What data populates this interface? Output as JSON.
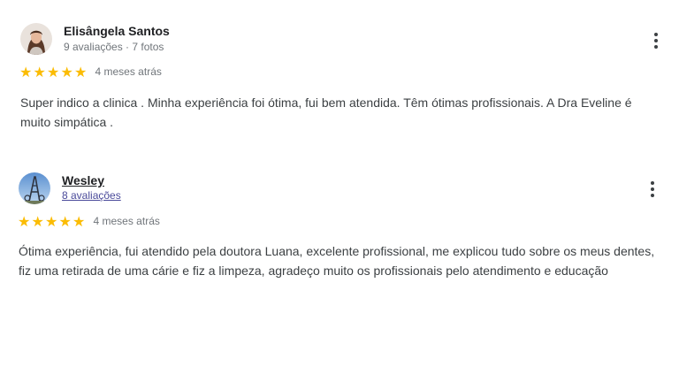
{
  "reviews": [
    {
      "author": "Elisângela Santos",
      "meta": "9 avaliações · 7 fotos",
      "rating": 5,
      "time": "4 meses atrás",
      "text": "Super indico a clinica . Minha experiência foi ótima, fui bem atendida. Têm ótimas profissionais. A Dra Eveline é muito simpática ."
    },
    {
      "author": "Wesley",
      "meta": "8 avaliações",
      "rating": 5,
      "time": "4 meses atrás",
      "text": "Ótima experiência, fui atendido pela doutora Luana, excelente profissional, me explicou tudo sobre os meus dentes, fiz uma retirada de uma cárie e fiz a limpeza, agradeço muito os profissionais pelo atendimento e educação"
    }
  ],
  "icons": {
    "star": "star-icon",
    "menu": "more-vert-icon"
  },
  "colors": {
    "star": "#fbbc04",
    "meta_link": "#4a4a9a"
  }
}
